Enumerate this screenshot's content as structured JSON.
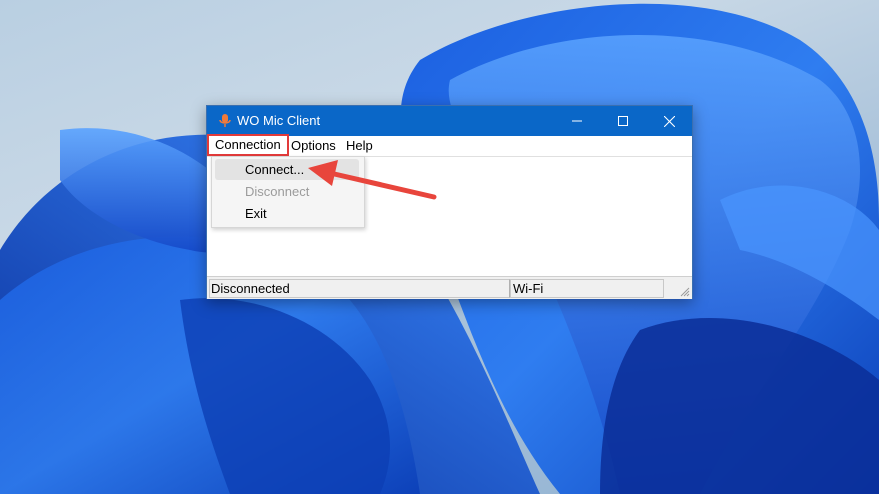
{
  "window": {
    "title": "WO Mic Client",
    "accent": "#0a67c8"
  },
  "menubar": {
    "items": [
      {
        "label": "Connection"
      },
      {
        "label": "Options"
      },
      {
        "label": "Help"
      }
    ]
  },
  "dropdown": {
    "items": [
      {
        "label": "Connect...",
        "enabled": true
      },
      {
        "label": "Disconnect",
        "enabled": false
      },
      {
        "label": "Exit",
        "enabled": true
      }
    ]
  },
  "statusbar": {
    "connection_status": "Disconnected",
    "transport": "Wi-Fi"
  },
  "annotation": {
    "highlight_color": "#e23a3a",
    "arrow_color": "#e8453c"
  }
}
